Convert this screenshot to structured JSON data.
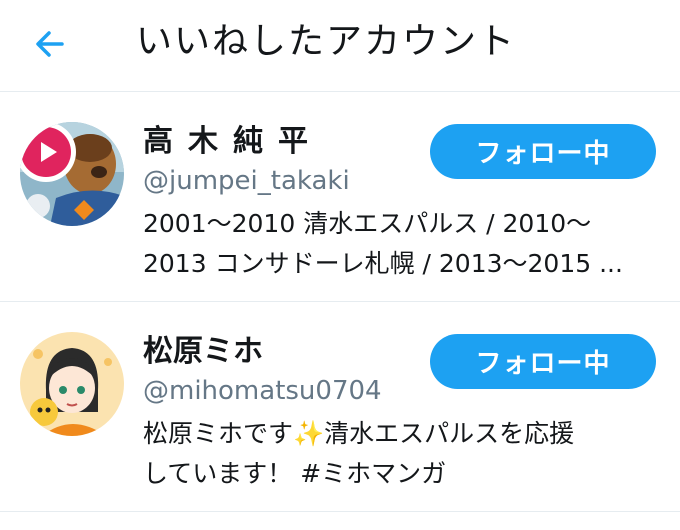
{
  "header": {
    "back_icon": "arrow-left-icon",
    "title": "いいねしたアカウント"
  },
  "accent_color": "#1da1f2",
  "users": [
    {
      "name": "高木純平",
      "handle": "@jumpei_takaki",
      "bio_lines": [
        "2001〜2010 清水エスパルス / 2010〜",
        "2013 コンサドーレ札幌 / 2013〜2015 ..."
      ],
      "follow_label": "フォロー中",
      "avatar_overlay_icon": "play-icon"
    },
    {
      "name": "松原ミホ",
      "handle": "@mihomatsu0704",
      "bio_lines": [
        "松原ミホです✨清水エスパルスを応援",
        "しています！ #ミホマンガ"
      ],
      "follow_label": "フォロー中"
    }
  ]
}
